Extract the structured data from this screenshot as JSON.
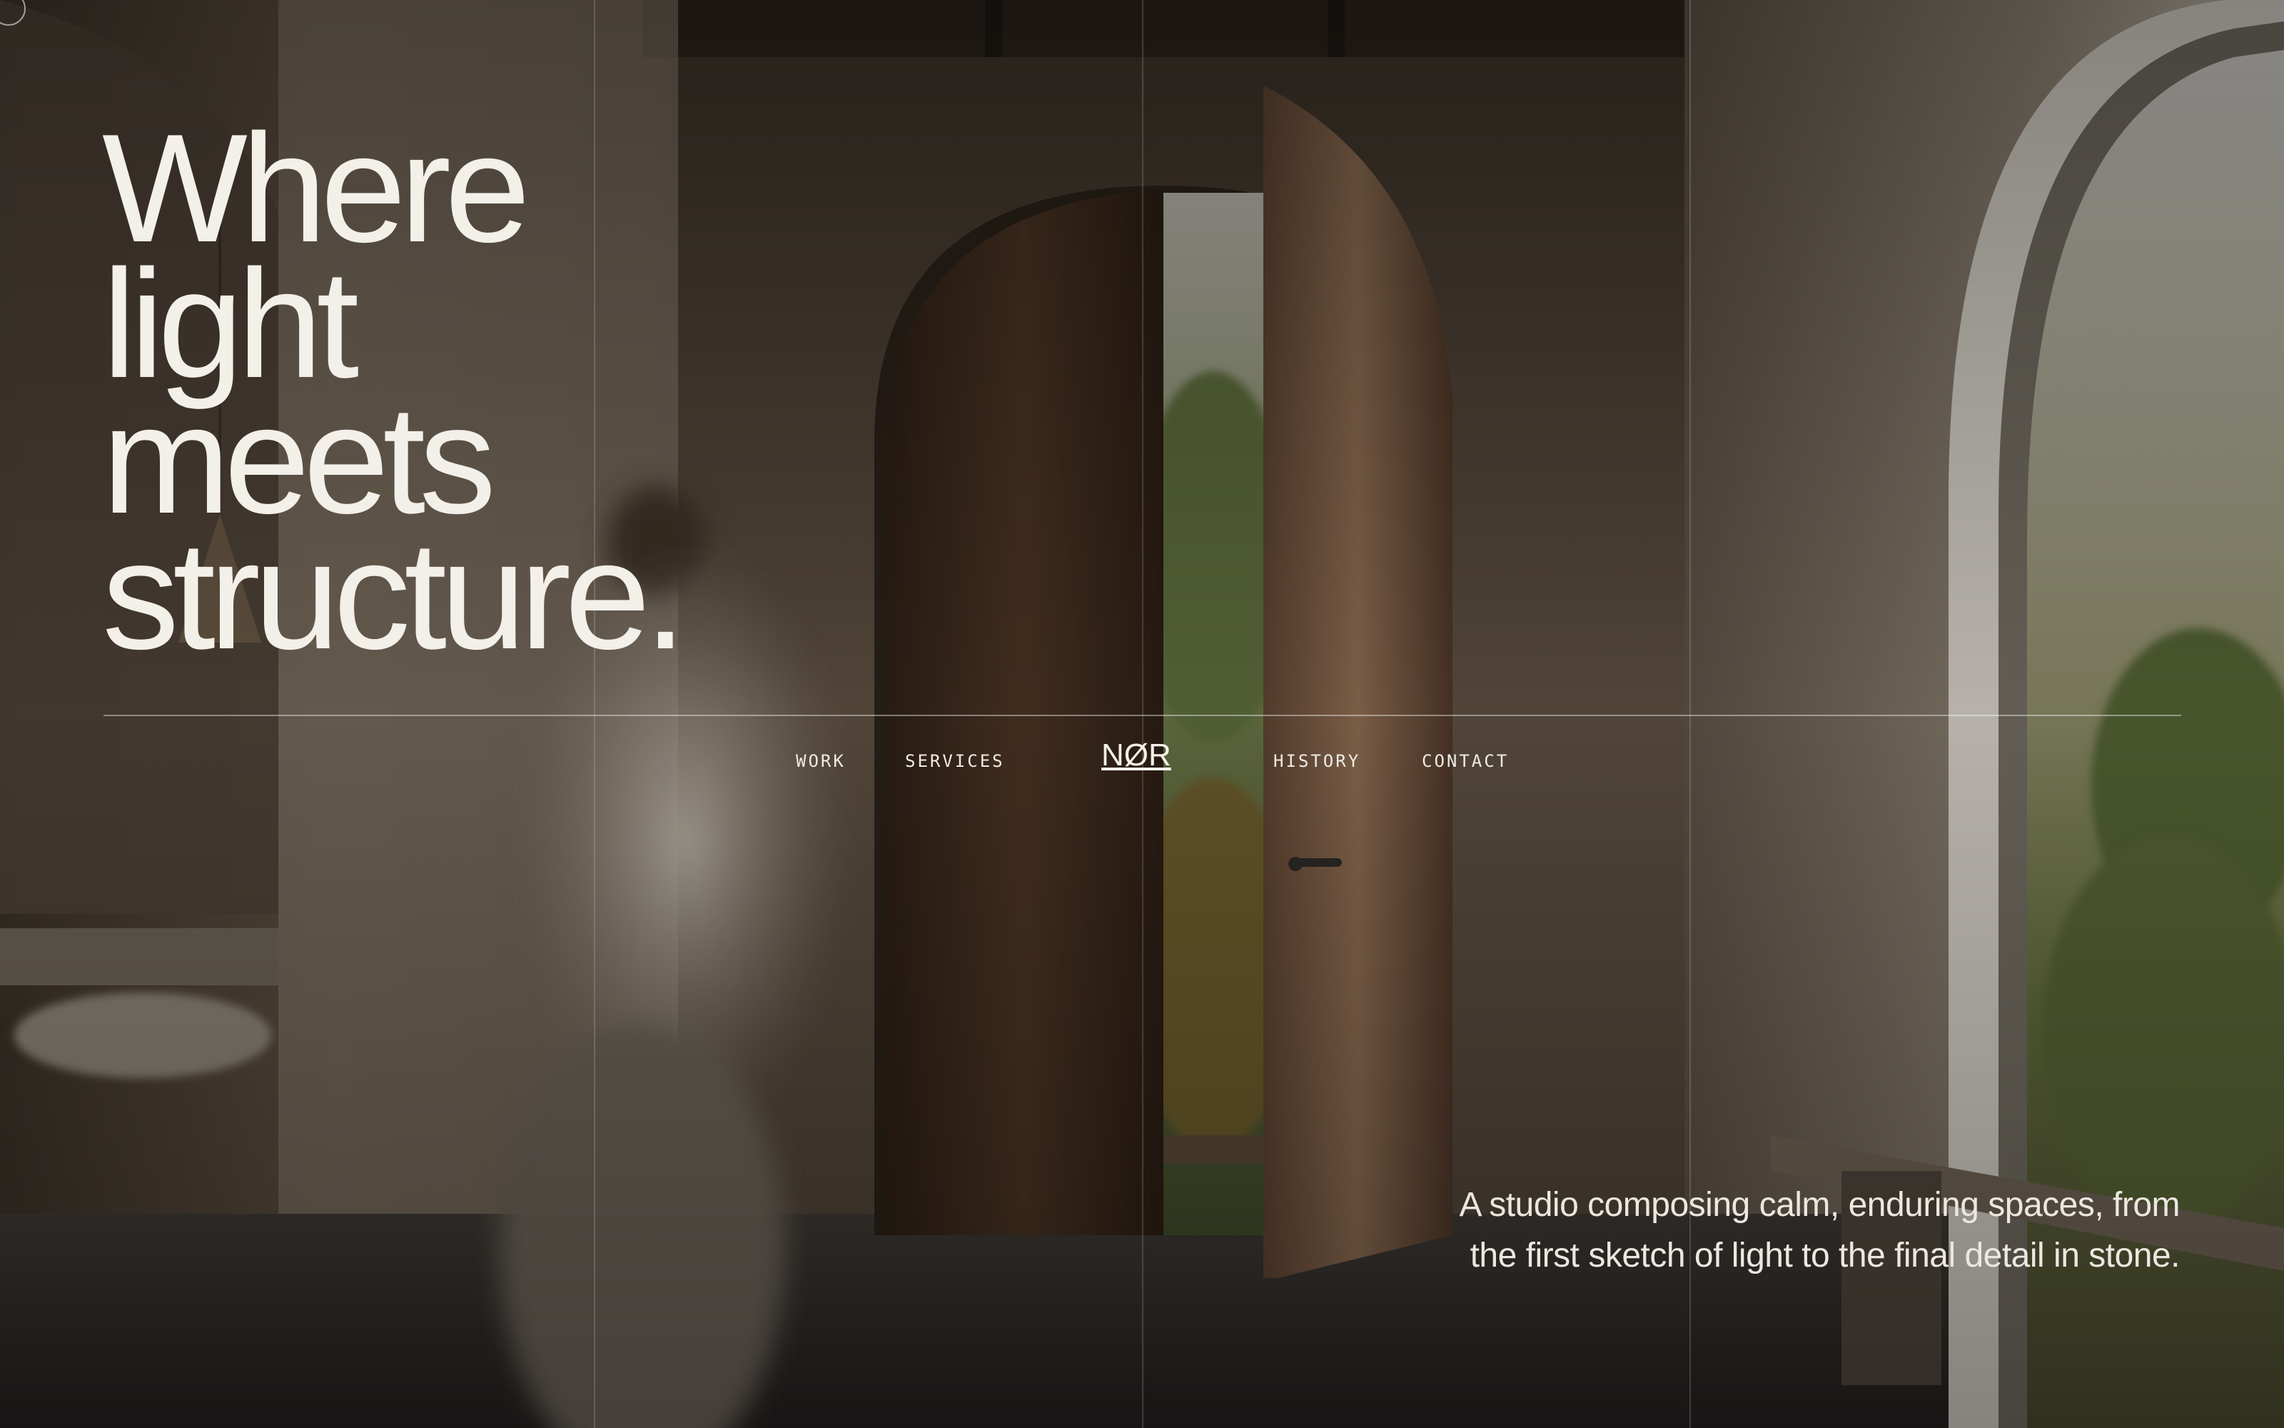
{
  "hero": {
    "headline_lines": [
      "Where",
      "light",
      "meets",
      "structure."
    ]
  },
  "nav": {
    "links": [
      "WORK",
      "SERVICES",
      "HISTORY",
      "CONTACT"
    ],
    "logo": "NØR"
  },
  "tagline": "A studio composing calm, enduring spaces, from the first sketch of light to the final detail in stone.",
  "colors": {
    "text": "#f3efe9",
    "background": "#1c1915",
    "grid_lines": "rgba(255,255,255,0.16)"
  },
  "icons": {
    "corner_mark": "circle-outline-icon"
  }
}
